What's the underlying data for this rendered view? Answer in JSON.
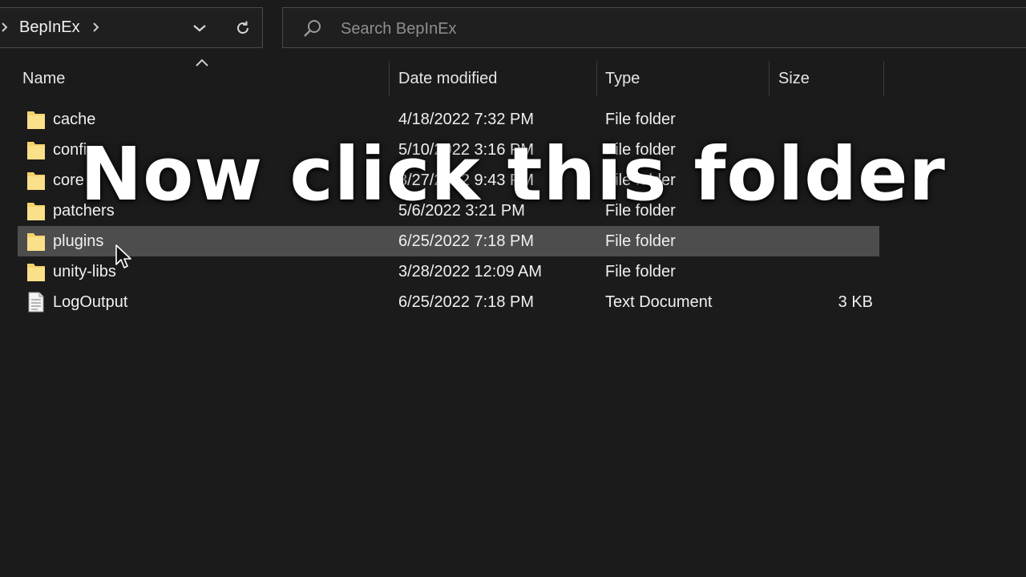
{
  "address_bar": {
    "crumb": "BepInEx",
    "icons": [
      "chevron-left-icon",
      "chevron-right-icon",
      "chevron-down-icon",
      "refresh-icon"
    ]
  },
  "search": {
    "placeholder": "Search BepInEx",
    "value": "",
    "icon": "search-icon"
  },
  "columns": {
    "name": "Name",
    "date": "Date modified",
    "type": "Type",
    "size": "Size",
    "sort_icon": "sort-ascending-icon"
  },
  "files": [
    {
      "name": "cache",
      "date": "4/18/2022 7:32 PM",
      "type": "File folder",
      "size": "",
      "icon": "folder-icon"
    },
    {
      "name": "config",
      "date": "5/10/2022 3:16 PM",
      "type": "File folder",
      "size": "",
      "icon": "folder-icon"
    },
    {
      "name": "core",
      "date": "3/27/2022 9:43 PM",
      "type": "File folder",
      "size": "",
      "icon": "folder-icon"
    },
    {
      "name": "patchers",
      "date": "5/6/2022 3:21 PM",
      "type": "File folder",
      "size": "",
      "icon": "folder-icon"
    },
    {
      "name": "plugins",
      "date": "6/25/2022 7:18 PM",
      "type": "File folder",
      "size": "",
      "icon": "folder-icon",
      "selected": true
    },
    {
      "name": "unity-libs",
      "date": "3/28/2022 12:09 AM",
      "type": "File folder",
      "size": "",
      "icon": "folder-icon"
    },
    {
      "name": "LogOutput",
      "date": "6/25/2022 7:18 PM",
      "type": "Text Document",
      "size": "3 KB",
      "icon": "text-document-icon"
    }
  ],
  "overlay": {
    "caption": "Now click this folder"
  },
  "colors": {
    "background": "#1b1b1b",
    "selected_row": "#4d4d4d",
    "folder_yellow": "#f5d36b",
    "text": "#f0f0f0"
  }
}
